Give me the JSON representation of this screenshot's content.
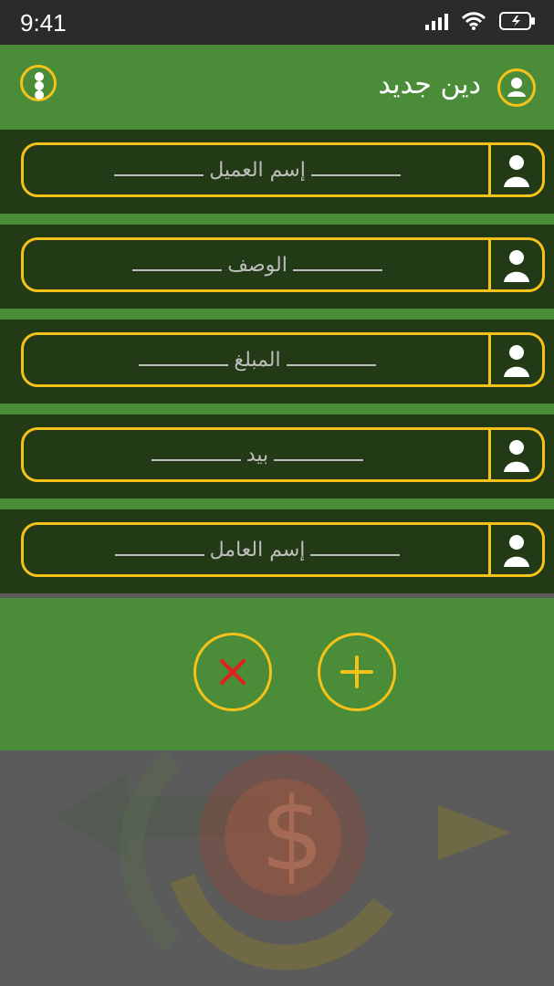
{
  "status": {
    "time": "9:41"
  },
  "header": {
    "title": "دين جديد"
  },
  "form": {
    "fields": [
      {
        "label": "إسم العميل"
      },
      {
        "label": "الوصف"
      },
      {
        "label": "المبلغ"
      },
      {
        "label": "بيد"
      },
      {
        "label": "إسم العامل"
      }
    ]
  },
  "colors": {
    "accent": "#f6c21a",
    "bar_green": "#4a8c38",
    "field_bg": "#223a16",
    "cancel_red": "#e11f1f"
  }
}
